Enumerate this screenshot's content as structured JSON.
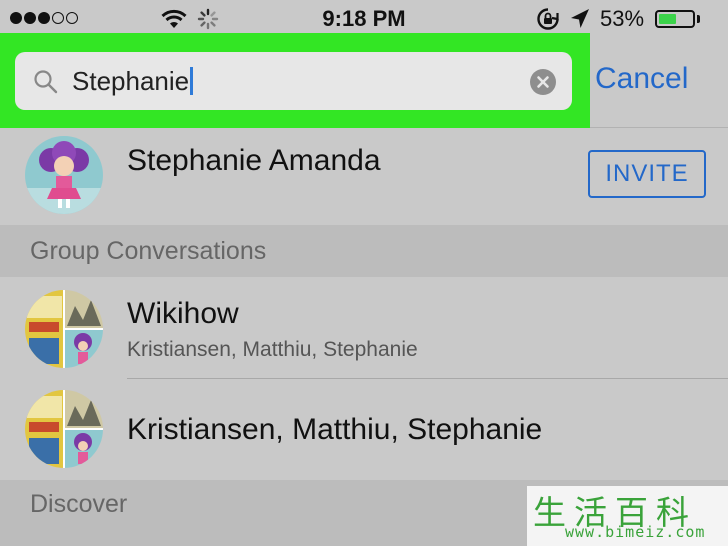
{
  "status_bar": {
    "time": "9:18 PM",
    "battery_percent": "53%",
    "battery_level": 0.53,
    "signal_dots_filled": 3,
    "signal_dots_total": 5,
    "icons": [
      "wifi-icon",
      "activity-spinner-icon",
      "rotation-lock-icon",
      "location-arrow-icon",
      "battery-icon"
    ]
  },
  "search": {
    "query": "Stephanie",
    "cancel_label": "Cancel",
    "highlight_color": "#33e624"
  },
  "contacts": [
    {
      "name": "Stephanie Amanda",
      "action_label": "INVITE"
    }
  ],
  "sections": {
    "group_conversations": "Group Conversations",
    "discover": "Discover"
  },
  "groups": [
    {
      "title": "Wikihow",
      "members": "Kristiansen, Matthiu, Stephanie"
    },
    {
      "title": "Kristiansen, Matthiu, Stephanie",
      "members": ""
    }
  ],
  "watermark": {
    "chars": "生活百科",
    "url": "www.bimeiz.com"
  },
  "colors": {
    "accent": "#2368c9",
    "background": "#c9c9c9",
    "section_bg": "#bcbcbc"
  }
}
